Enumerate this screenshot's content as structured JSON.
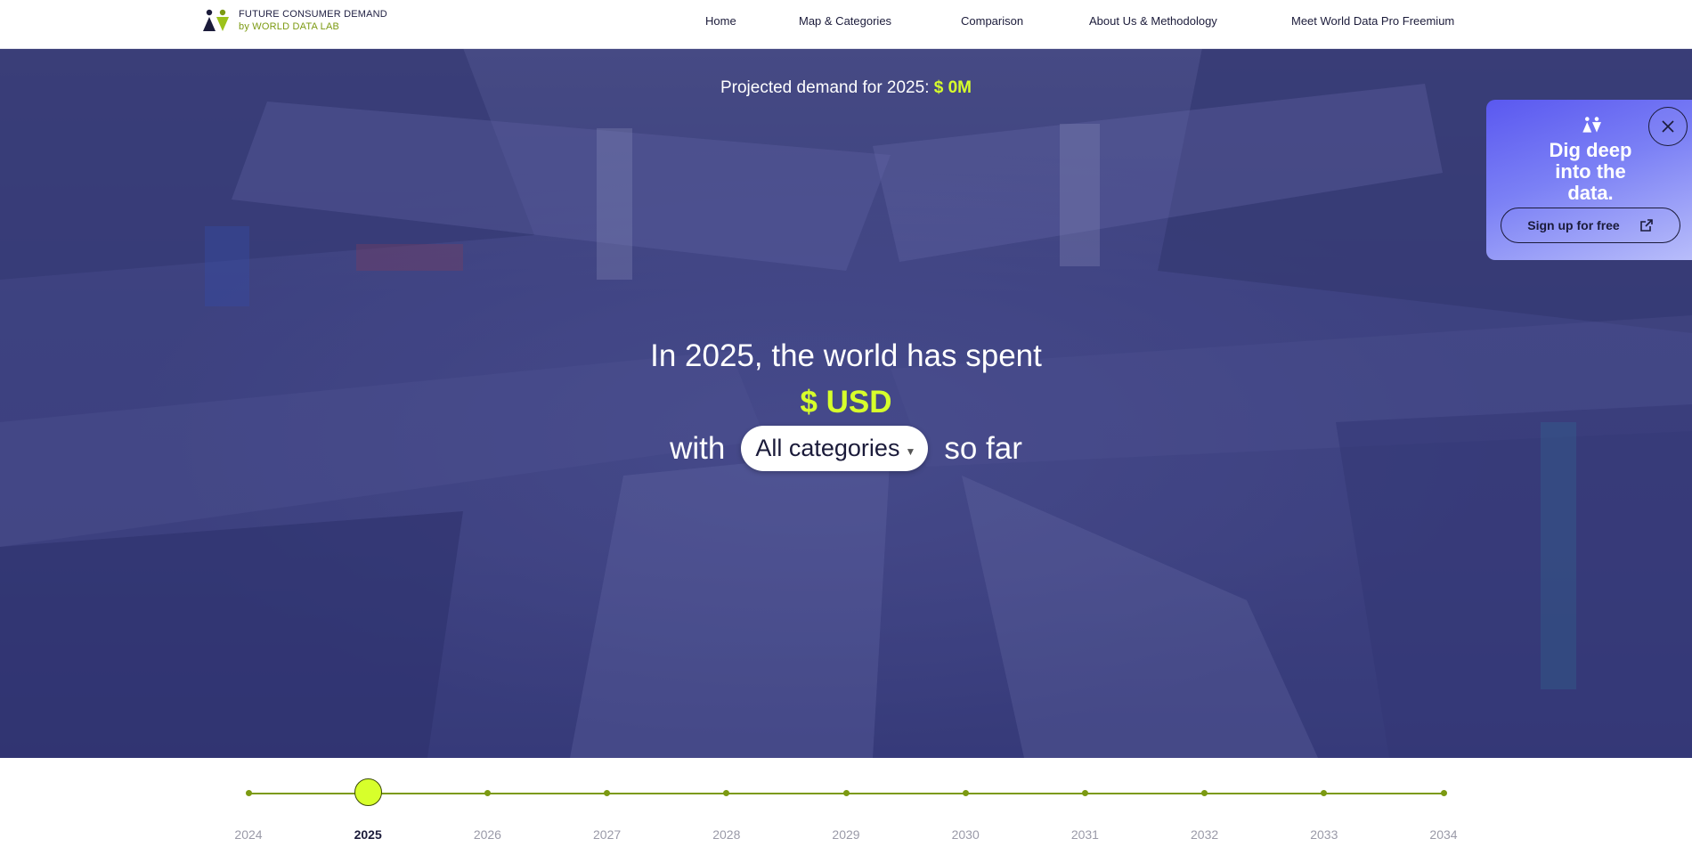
{
  "brand": {
    "line1": "FUTURE CONSUMER DEMAND",
    "line2": "by WORLD DATA LAB"
  },
  "nav": [
    {
      "label": "Home"
    },
    {
      "label": "Map & Categories"
    },
    {
      "label": "Comparison"
    },
    {
      "label": "About Us & Methodology"
    },
    {
      "label": "Meet World Data Pro Freemium"
    }
  ],
  "hero": {
    "projected_label": "Projected demand for 2025:",
    "projected_value": "$ 0M",
    "headline": "In 2025, the world has spent",
    "amount": "$ USD",
    "with": "with",
    "category_selected": "All categories",
    "so_far": "so far"
  },
  "promo": {
    "title": "Dig deep\ninto the\ndata.",
    "button_label": "Sign up for free"
  },
  "timeline": {
    "years": [
      "2024",
      "2025",
      "2026",
      "2027",
      "2028",
      "2029",
      "2030",
      "2031",
      "2032",
      "2033",
      "2034"
    ],
    "selected": "2025"
  },
  "colors": {
    "accent": "#d7ff2b",
    "brand_green": "#7c9a12",
    "navy": "#1b1b3a",
    "hero_overlay": "#2d3078"
  },
  "icons": {
    "logo": "wdl-logo-icon",
    "external": "external-link-icon",
    "close": "close-icon",
    "caret": "caret-down-icon"
  }
}
